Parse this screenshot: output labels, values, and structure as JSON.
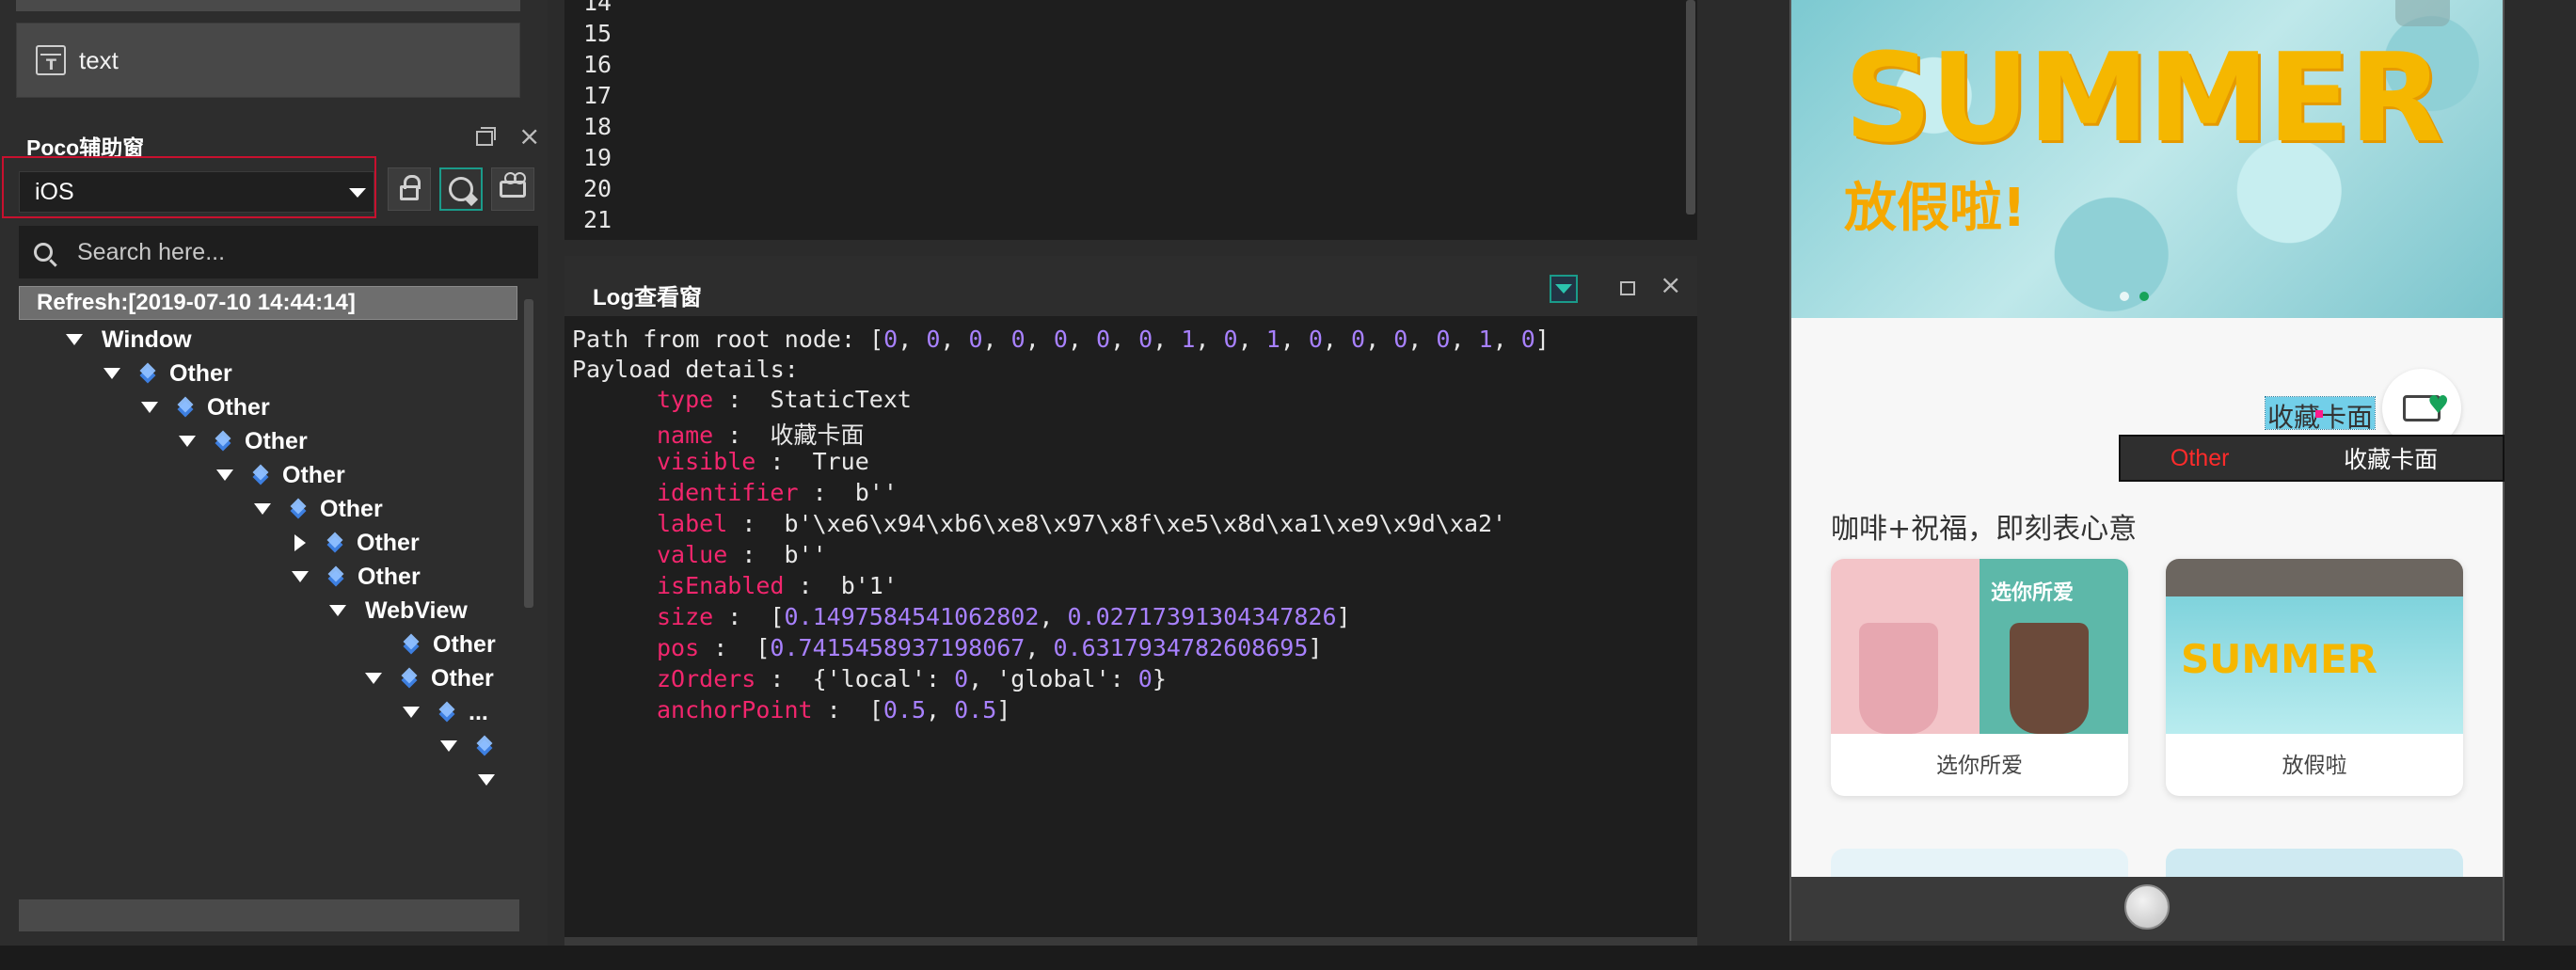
{
  "left": {
    "text_item_label": "text",
    "poco_title": "Poco辅助窗",
    "platform_value": "iOS",
    "search_placeholder": "Search here...",
    "refresh_label": "Refresh:[2019-07-10 14:44:14]",
    "tree": [
      {
        "label": "Window",
        "arrow": "down",
        "icon": false
      },
      {
        "label": "Other",
        "arrow": "down",
        "icon": true
      },
      {
        "label": "Other",
        "arrow": "down",
        "icon": true
      },
      {
        "label": "Other",
        "arrow": "down",
        "icon": true
      },
      {
        "label": "Other",
        "arrow": "down",
        "icon": true
      },
      {
        "label": "Other",
        "arrow": "down",
        "icon": true
      },
      {
        "label": "Other",
        "arrow": "right",
        "icon": true
      },
      {
        "label": "Other",
        "arrow": "down",
        "icon": true
      },
      {
        "label": "WebView",
        "arrow": "down",
        "icon": false
      },
      {
        "label": "Other",
        "arrow": "none",
        "icon": true
      },
      {
        "label": "Other",
        "arrow": "down",
        "icon": true
      },
      {
        "label": "...",
        "arrow": "down",
        "icon": true
      },
      {
        "label": "",
        "arrow": "down",
        "icon": true
      },
      {
        "label": "",
        "arrow": "down",
        "icon": false
      }
    ]
  },
  "code": {
    "line_numbers": [
      "14",
      "15",
      "16",
      "17",
      "18",
      "19",
      "20",
      "21"
    ]
  },
  "log": {
    "title": "Log查看窗",
    "path_prefix": "Path from root node: ",
    "path_values": [
      0,
      0,
      0,
      0,
      0,
      0,
      0,
      1,
      0,
      1,
      0,
      0,
      0,
      0,
      1,
      0
    ],
    "payload_header": "Payload details:",
    "details": {
      "type": "StaticText",
      "name": "收藏卡面",
      "visible": "True",
      "identifier": "b''",
      "label": "b'\\xe6\\x94\\xb6\\xe8\\x97\\x8f\\xe5\\x8d\\xa1\\xe9\\x9d\\xa2'",
      "value": "b''",
      "isEnabled": "b'1'",
      "size": [
        "0.1497584541062802",
        "0.02717391304347826"
      ],
      "pos": [
        "0.7415458937198067",
        "0.6317934782608695"
      ],
      "zOrders_local": "0",
      "zOrders_global": "0",
      "anchorPoint": [
        "0.5",
        "0.5"
      ]
    }
  },
  "phone": {
    "banner_title": "SUMMER",
    "banner_sub": "放假啦!",
    "fav_label": "收藏卡面",
    "heart": "♥",
    "tooltip_type": "Other",
    "tooltip_name": "收藏卡面",
    "section_title": "咖啡+祝福，即刻表心意",
    "cards": [
      {
        "caption": "选你所爱",
        "art_text": "选你所爱"
      },
      {
        "caption": "放假啦",
        "art_text": "SUMMER"
      }
    ]
  },
  "colors": {
    "accent_teal": "#1a9b8a",
    "highlight_red": "#c8102e",
    "key_pink": "#f2266d",
    "num_purple": "#a881ff",
    "banner_yellow": "#f5b700"
  }
}
